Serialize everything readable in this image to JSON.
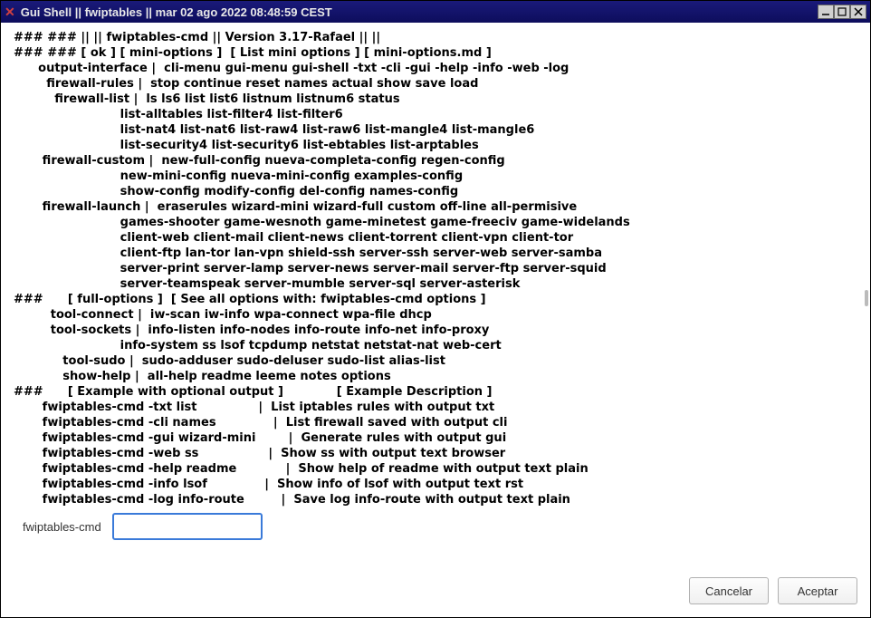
{
  "titlebar": {
    "title": "Gui Shell || fwiptables || mar 02 ago 2022 08:48:59 CEST"
  },
  "body": {
    "lines": [
      "### ### || || fwiptables-cmd || Version 3.17-Rafael || ||",
      "### ### [ ok ] [ mini-options ]  [ List mini options ] [ mini-options.md ]",
      "      output-interface |  cli-menu gui-menu gui-shell -txt -cli -gui -help -info -web -log",
      "        firewall-rules |  stop continue reset names actual show save load",
      "          firewall-list |  ls ls6 list list6 listnum listnum6 status",
      "                          list-alltables list-filter4 list-filter6",
      "                          list-nat4 list-nat6 list-raw4 list-raw6 list-mangle4 list-mangle6",
      "                          list-security4 list-security6 list-ebtables list-arptables",
      "       firewall-custom |  new-full-config nueva-completa-config regen-config",
      "                          new-mini-config nueva-mini-config examples-config",
      "                          show-config modify-config del-config names-config",
      "       firewall-launch |  eraserules wizard-mini wizard-full custom off-line all-permisive",
      "                          games-shooter game-wesnoth game-minetest game-freeciv game-widelands",
      "                          client-web client-mail client-news client-torrent client-vpn client-tor",
      "                          client-ftp lan-tor lan-vpn shield-ssh server-ssh server-web server-samba",
      "                          server-print server-lamp server-news server-mail server-ftp server-squid",
      "                          server-teamspeak server-mumble server-sql server-asterisk",
      "###      [ full-options ]  [ See all options with: fwiptables-cmd options ]",
      "         tool-connect |  iw-scan iw-info wpa-connect wpa-file dhcp",
      "         tool-sockets |  info-listen info-nodes info-route info-net info-proxy",
      "                          info-system ss lsof tcpdump netstat netstat-nat web-cert",
      "            tool-sudo |  sudo-adduser sudo-deluser sudo-list alias-list",
      "            show-help |  all-help readme leeme notes options",
      "###      [ Example with optional output ]             [ Example Description ]",
      "       fwiptables-cmd -txt list               |  List iptables rules with output txt",
      "       fwiptables-cmd -cli names              |  List firewall saved with output cli",
      "       fwiptables-cmd -gui wizard-mini        |  Generate rules with output gui",
      "       fwiptables-cmd -web ss                 |  Show ss with output text browser",
      "       fwiptables-cmd -help readme            |  Show help of readme with output text plain",
      "       fwiptables-cmd -info lsof              |  Show info of lsof with output text rst",
      "       fwiptables-cmd -log info-route         |  Save log info-route with output text plain"
    ]
  },
  "input": {
    "label": "fwiptables-cmd",
    "value": ""
  },
  "buttons": {
    "cancel": "Cancelar",
    "accept": "Aceptar"
  }
}
